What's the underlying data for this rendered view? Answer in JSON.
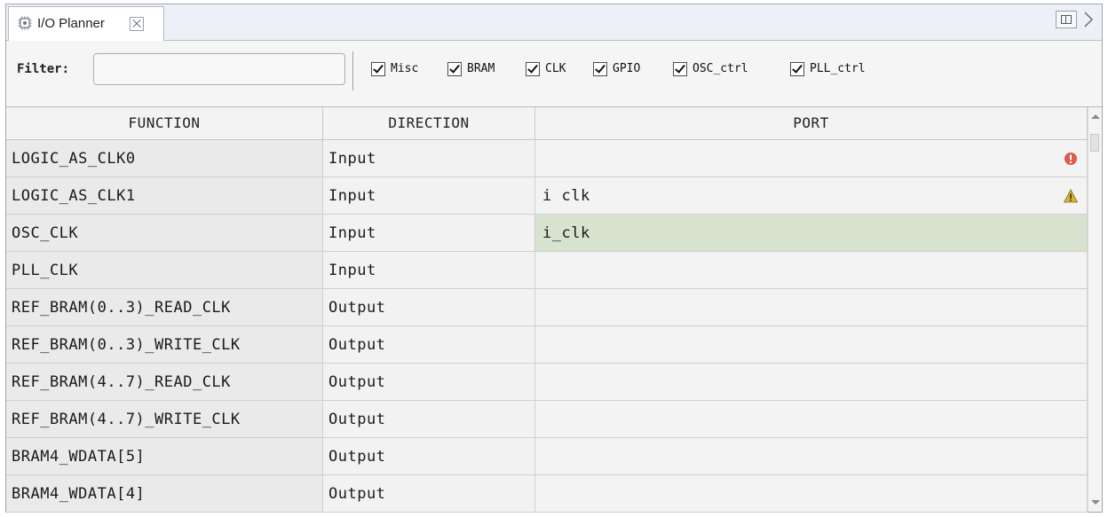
{
  "tab": {
    "title": "I/O Planner",
    "icon": "chip-wrench-icon"
  },
  "filter": {
    "label": "Filter:",
    "value": "",
    "checkboxes": [
      {
        "label": "Misc",
        "checked": true
      },
      {
        "label": "BRAM",
        "checked": true
      },
      {
        "label": "CLK",
        "checked": true
      },
      {
        "label": "GPIO",
        "checked": true
      },
      {
        "label": "OSC_ctrl",
        "checked": true
      },
      {
        "label": "PLL_ctrl",
        "checked": true
      }
    ]
  },
  "table": {
    "headers": [
      "FUNCTION",
      "DIRECTION",
      "PORT"
    ],
    "rows": [
      {
        "function": "LOGIC_AS_CLK0",
        "direction": "Input",
        "port": "",
        "status": "error",
        "status_icon": "error-icon"
      },
      {
        "function": "LOGIC_AS_CLK1",
        "direction": "Input",
        "port": "i clk",
        "status": "warning",
        "status_icon": "warning-icon"
      },
      {
        "function": "OSC_CLK",
        "direction": "Input",
        "port": "i_clk",
        "status": "selected"
      },
      {
        "function": "PLL_CLK",
        "direction": "Input",
        "port": ""
      },
      {
        "function": "REF_BRAM(0..3)_READ_CLK",
        "direction": "Output",
        "port": ""
      },
      {
        "function": "REF_BRAM(0..3)_WRITE_CLK",
        "direction": "Output",
        "port": ""
      },
      {
        "function": "REF_BRAM(4..7)_READ_CLK",
        "direction": "Output",
        "port": ""
      },
      {
        "function": "REF_BRAM(4..7)_WRITE_CLK",
        "direction": "Output",
        "port": ""
      },
      {
        "function": "BRAM4_WDATA[5]",
        "direction": "Output",
        "port": ""
      },
      {
        "function": "BRAM4_WDATA[4]",
        "direction": "Output",
        "port": ""
      }
    ]
  },
  "colors": {
    "selected_row": "#d7e3cf",
    "error": "#e05a4e",
    "warning": "#d9b13a"
  }
}
